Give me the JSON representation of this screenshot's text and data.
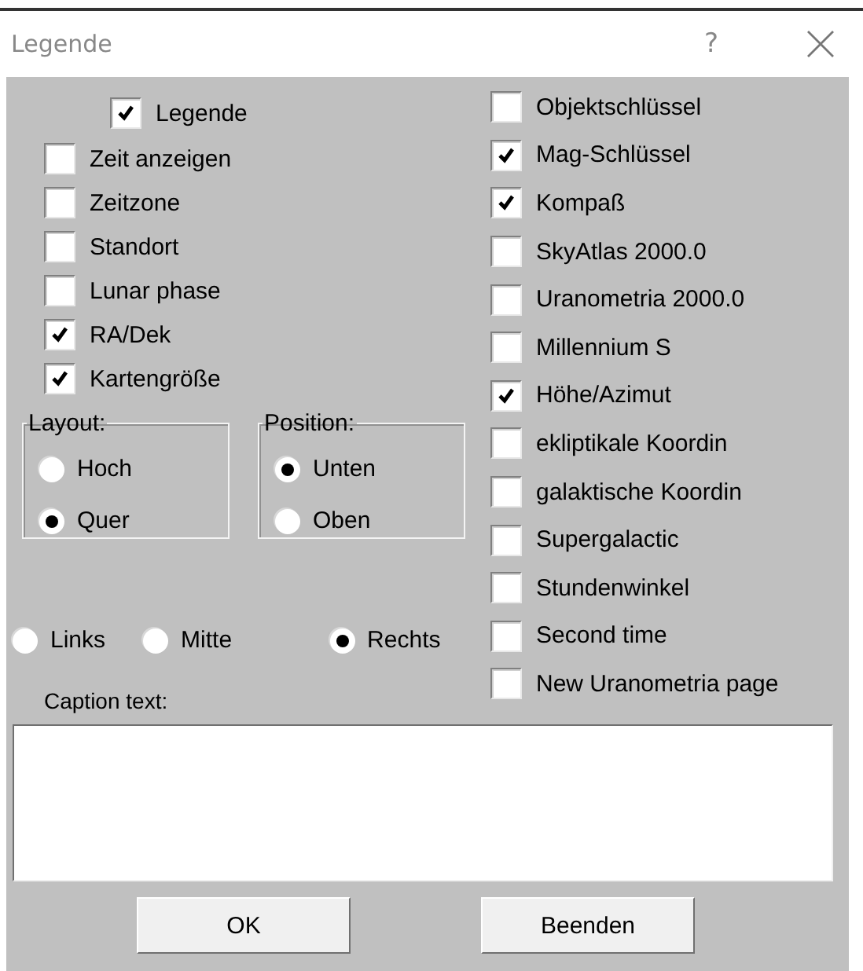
{
  "window": {
    "title": "Legende",
    "help_button": "?"
  },
  "legend": {
    "label": "Legende",
    "checked": true
  },
  "left_options": [
    {
      "label": "Zeit anzeigen",
      "checked": false
    },
    {
      "label": "Zeitzone",
      "checked": false
    },
    {
      "label": "Standort",
      "checked": false
    },
    {
      "label": "Lunar phase",
      "checked": false
    },
    {
      "label": "RA/Dek",
      "checked": true
    },
    {
      "label": "Kartengröße",
      "checked": true
    }
  ],
  "groups": [
    {
      "title": "Layout:",
      "options": [
        {
          "label": "Hoch",
          "selected": false
        },
        {
          "label": "Quer",
          "selected": true
        }
      ]
    },
    {
      "title": "Position:",
      "options": [
        {
          "label": "Unten",
          "selected": true
        },
        {
          "label": "Oben",
          "selected": false
        }
      ]
    }
  ],
  "alignment": [
    {
      "label": "Links",
      "selected": false
    },
    {
      "label": "Mitte",
      "selected": false
    },
    {
      "label": "Rechts",
      "selected": true
    }
  ],
  "right_options": [
    {
      "label": "Objektschlüssel",
      "checked": false
    },
    {
      "label": "Mag-Schlüssel",
      "checked": true
    },
    {
      "label": "Kompaß",
      "checked": true
    },
    {
      "label": "SkyAtlas 2000.0",
      "checked": false
    },
    {
      "label": "Uranometria 2000.0",
      "checked": false
    },
    {
      "label": "Millennium S",
      "checked": false
    },
    {
      "label": "Höhe/Azimut",
      "checked": true
    },
    {
      "label": "ekliptikale Koordin",
      "checked": false
    },
    {
      "label": "galaktische Koordin",
      "checked": false
    },
    {
      "label": "Supergalactic",
      "checked": false
    },
    {
      "label": "Stundenwinkel",
      "checked": false
    },
    {
      "label": "Second time",
      "checked": false
    },
    {
      "label": "New Uranometria page",
      "checked": false
    }
  ],
  "caption": {
    "label": "Caption text:"
  },
  "buttons": [
    "OK",
    "Beenden"
  ]
}
